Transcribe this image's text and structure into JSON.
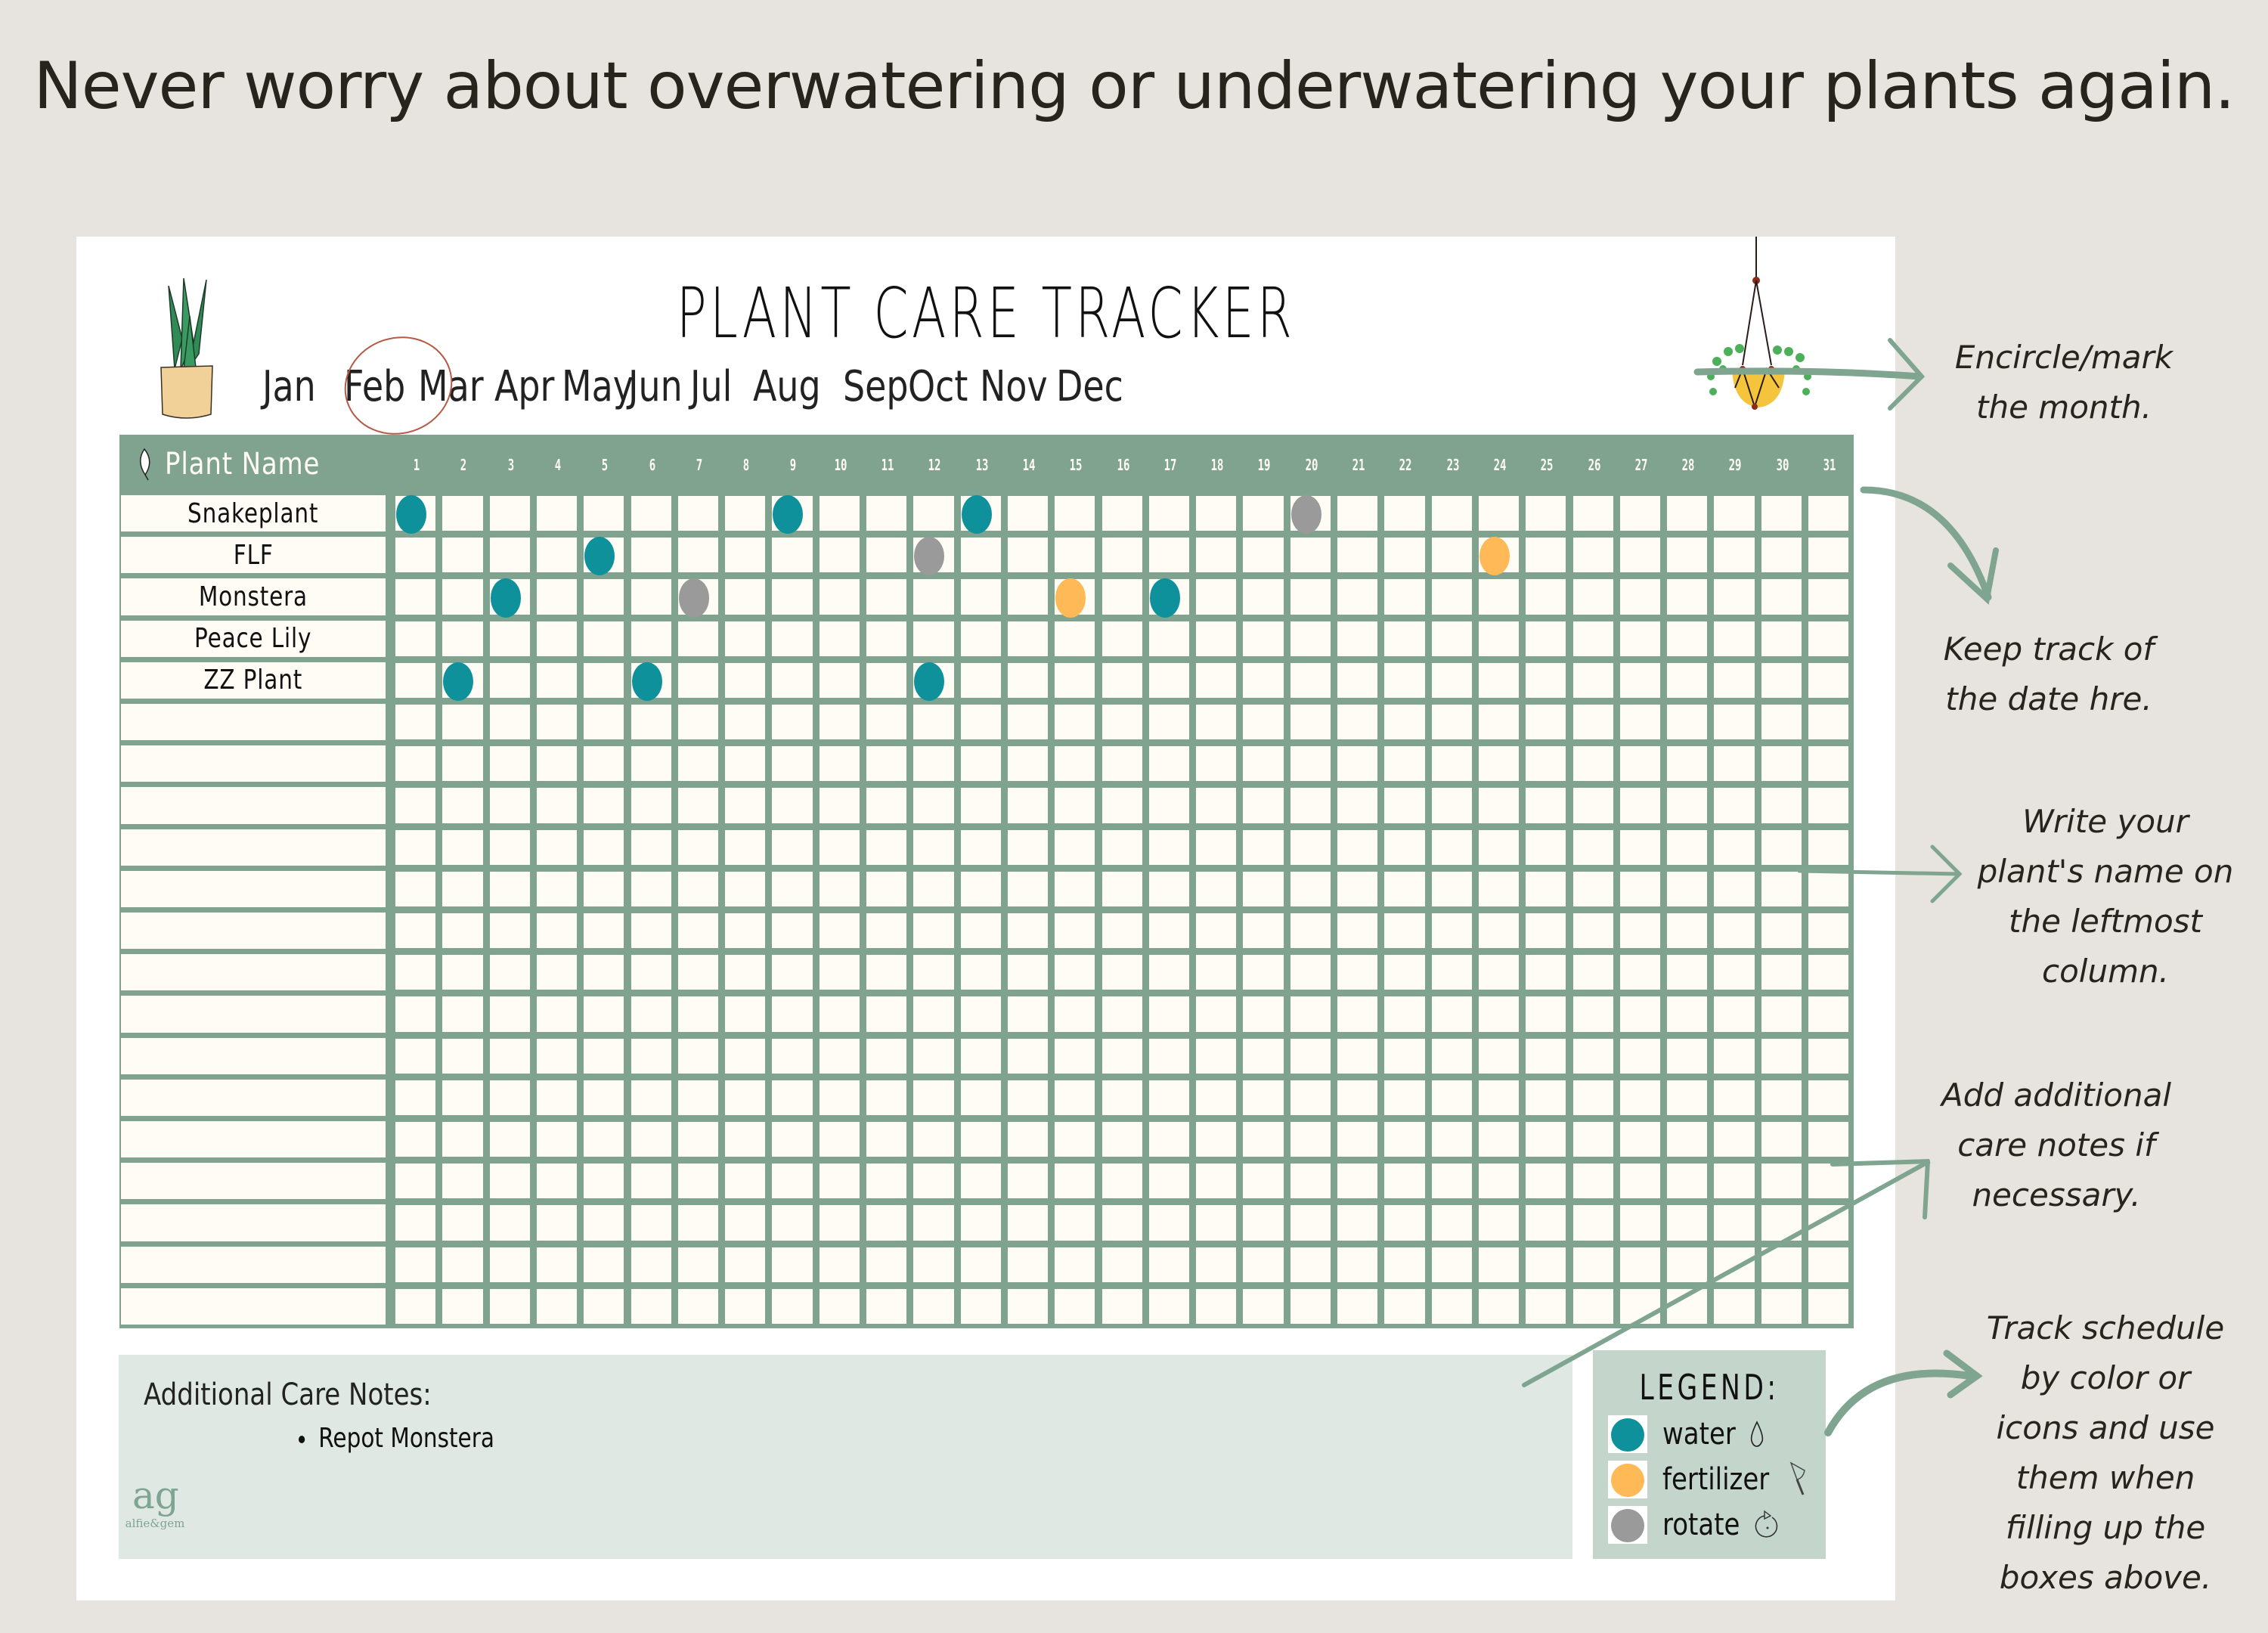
{
  "headline": "Never worry about overwatering or underwatering your plants again.",
  "tracker": {
    "title": "PLANT CARE TRACKER",
    "months": [
      "Jan",
      "Feb",
      "Mar",
      "Apr",
      "May",
      "Jun",
      "Jul",
      "Aug",
      "Sep",
      "Oct",
      "Nov",
      "Dec"
    ],
    "selected_month": "Feb",
    "name_header": "Plant Name",
    "days": [
      "1",
      "2",
      "3",
      "4",
      "5",
      "6",
      "7",
      "8",
      "9",
      "10",
      "11",
      "12",
      "13",
      "14",
      "15",
      "16",
      "17",
      "18",
      "19",
      "20",
      "21",
      "22",
      "23",
      "24",
      "25",
      "26",
      "27",
      "28",
      "29",
      "30",
      "31"
    ],
    "total_rows": 20,
    "plants": [
      {
        "name": "Snakeplant",
        "marks": [
          {
            "day": 1,
            "type": "water"
          },
          {
            "day": 9,
            "type": "water"
          },
          {
            "day": 13,
            "type": "water"
          },
          {
            "day": 20,
            "type": "rotate"
          }
        ]
      },
      {
        "name": "FLF",
        "marks": [
          {
            "day": 5,
            "type": "water"
          },
          {
            "day": 12,
            "type": "rotate"
          },
          {
            "day": 24,
            "type": "fertilizer"
          }
        ]
      },
      {
        "name": "Monstera",
        "marks": [
          {
            "day": 3,
            "type": "water"
          },
          {
            "day": 7,
            "type": "rotate"
          },
          {
            "day": 15,
            "type": "fertilizer"
          },
          {
            "day": 17,
            "type": "water"
          }
        ]
      },
      {
        "name": "Peace Lily",
        "marks": []
      },
      {
        "name": "ZZ Plant",
        "marks": [
          {
            "day": 2,
            "type": "water"
          },
          {
            "day": 6,
            "type": "water"
          },
          {
            "day": 12,
            "type": "water"
          }
        ]
      }
    ],
    "notes": {
      "title": "Additional Care Notes:",
      "items": [
        "Repot Monstera"
      ]
    },
    "logo": {
      "mark": "ag",
      "brand": "alfie&gem"
    },
    "legend": {
      "title": "LEGEND:",
      "items": [
        {
          "type": "water",
          "label": "water",
          "icon": "water-drop-icon",
          "glyph": "́",
          "color": "#0f919c"
        },
        {
          "type": "fertilizer",
          "label": "fertilizer",
          "icon": "trowel-icon",
          "color": "#ffb957"
        },
        {
          "type": "rotate",
          "label": "rotate",
          "icon": "rotate-icon",
          "color": "#9a9a9a"
        }
      ]
    }
  },
  "annotations": [
    "Encircle/mark the month.",
    "Keep track of the date hre.",
    "Write your plant's name on the leftmost column.",
    "Add additional care notes if necessary.",
    "Track schedule by color or icons and use them when filling up the boxes above."
  ],
  "annotation_lines": [
    [
      "Encircle/mark",
      "the month."
    ],
    [
      "Keep track of",
      "the date hre."
    ],
    [
      "Write your",
      "plant's name on",
      "the leftmost",
      "column."
    ],
    [
      "Add additional",
      "care notes if",
      "necessary."
    ],
    [
      "Track schedule",
      "by color or",
      "icons and use",
      "them when",
      "filling up the",
      "boxes above."
    ]
  ],
  "colors": {
    "background": "#e7e3df",
    "grid_green": "#80a390",
    "cell": "#fefcf5",
    "water": "#0f919c",
    "fertilizer": "#ffb957",
    "rotate": "#9a9a9a",
    "notes_bg": "#dfe8e3",
    "legend_bg": "#c4d5cb",
    "month_circle": "#b45a46"
  }
}
